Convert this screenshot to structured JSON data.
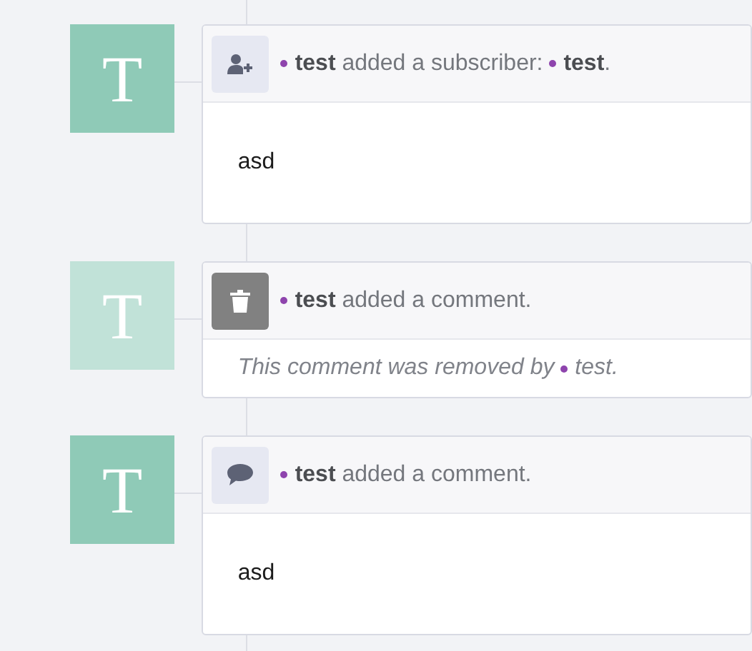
{
  "events": [
    {
      "avatar": {
        "letter": "T",
        "faded": false
      },
      "kind": "subscriber",
      "header": [
        {
          "kind": "user",
          "text": "test"
        },
        {
          "kind": "text",
          "text": " added a subscriber: "
        },
        {
          "kind": "user",
          "text": "test"
        },
        {
          "kind": "text",
          "text": "."
        }
      ],
      "body": {
        "kind": "text",
        "parts": [
          {
            "kind": "text",
            "text": "asd"
          }
        ]
      }
    },
    {
      "avatar": {
        "letter": "T",
        "faded": true
      },
      "kind": "trash",
      "header": [
        {
          "kind": "user",
          "text": "test"
        },
        {
          "kind": "text",
          "text": " added a comment."
        }
      ],
      "body": {
        "kind": "removed",
        "parts": [
          {
            "kind": "text",
            "text": "This comment was removed by "
          },
          {
            "kind": "user",
            "text": "test."
          }
        ]
      }
    },
    {
      "avatar": {
        "letter": "T",
        "faded": false
      },
      "kind": "comment",
      "header": [
        {
          "kind": "user",
          "text": "test"
        },
        {
          "kind": "text",
          "text": " added a comment."
        }
      ],
      "body": {
        "kind": "text",
        "parts": [
          {
            "kind": "text",
            "text": "asd"
          }
        ]
      }
    }
  ]
}
